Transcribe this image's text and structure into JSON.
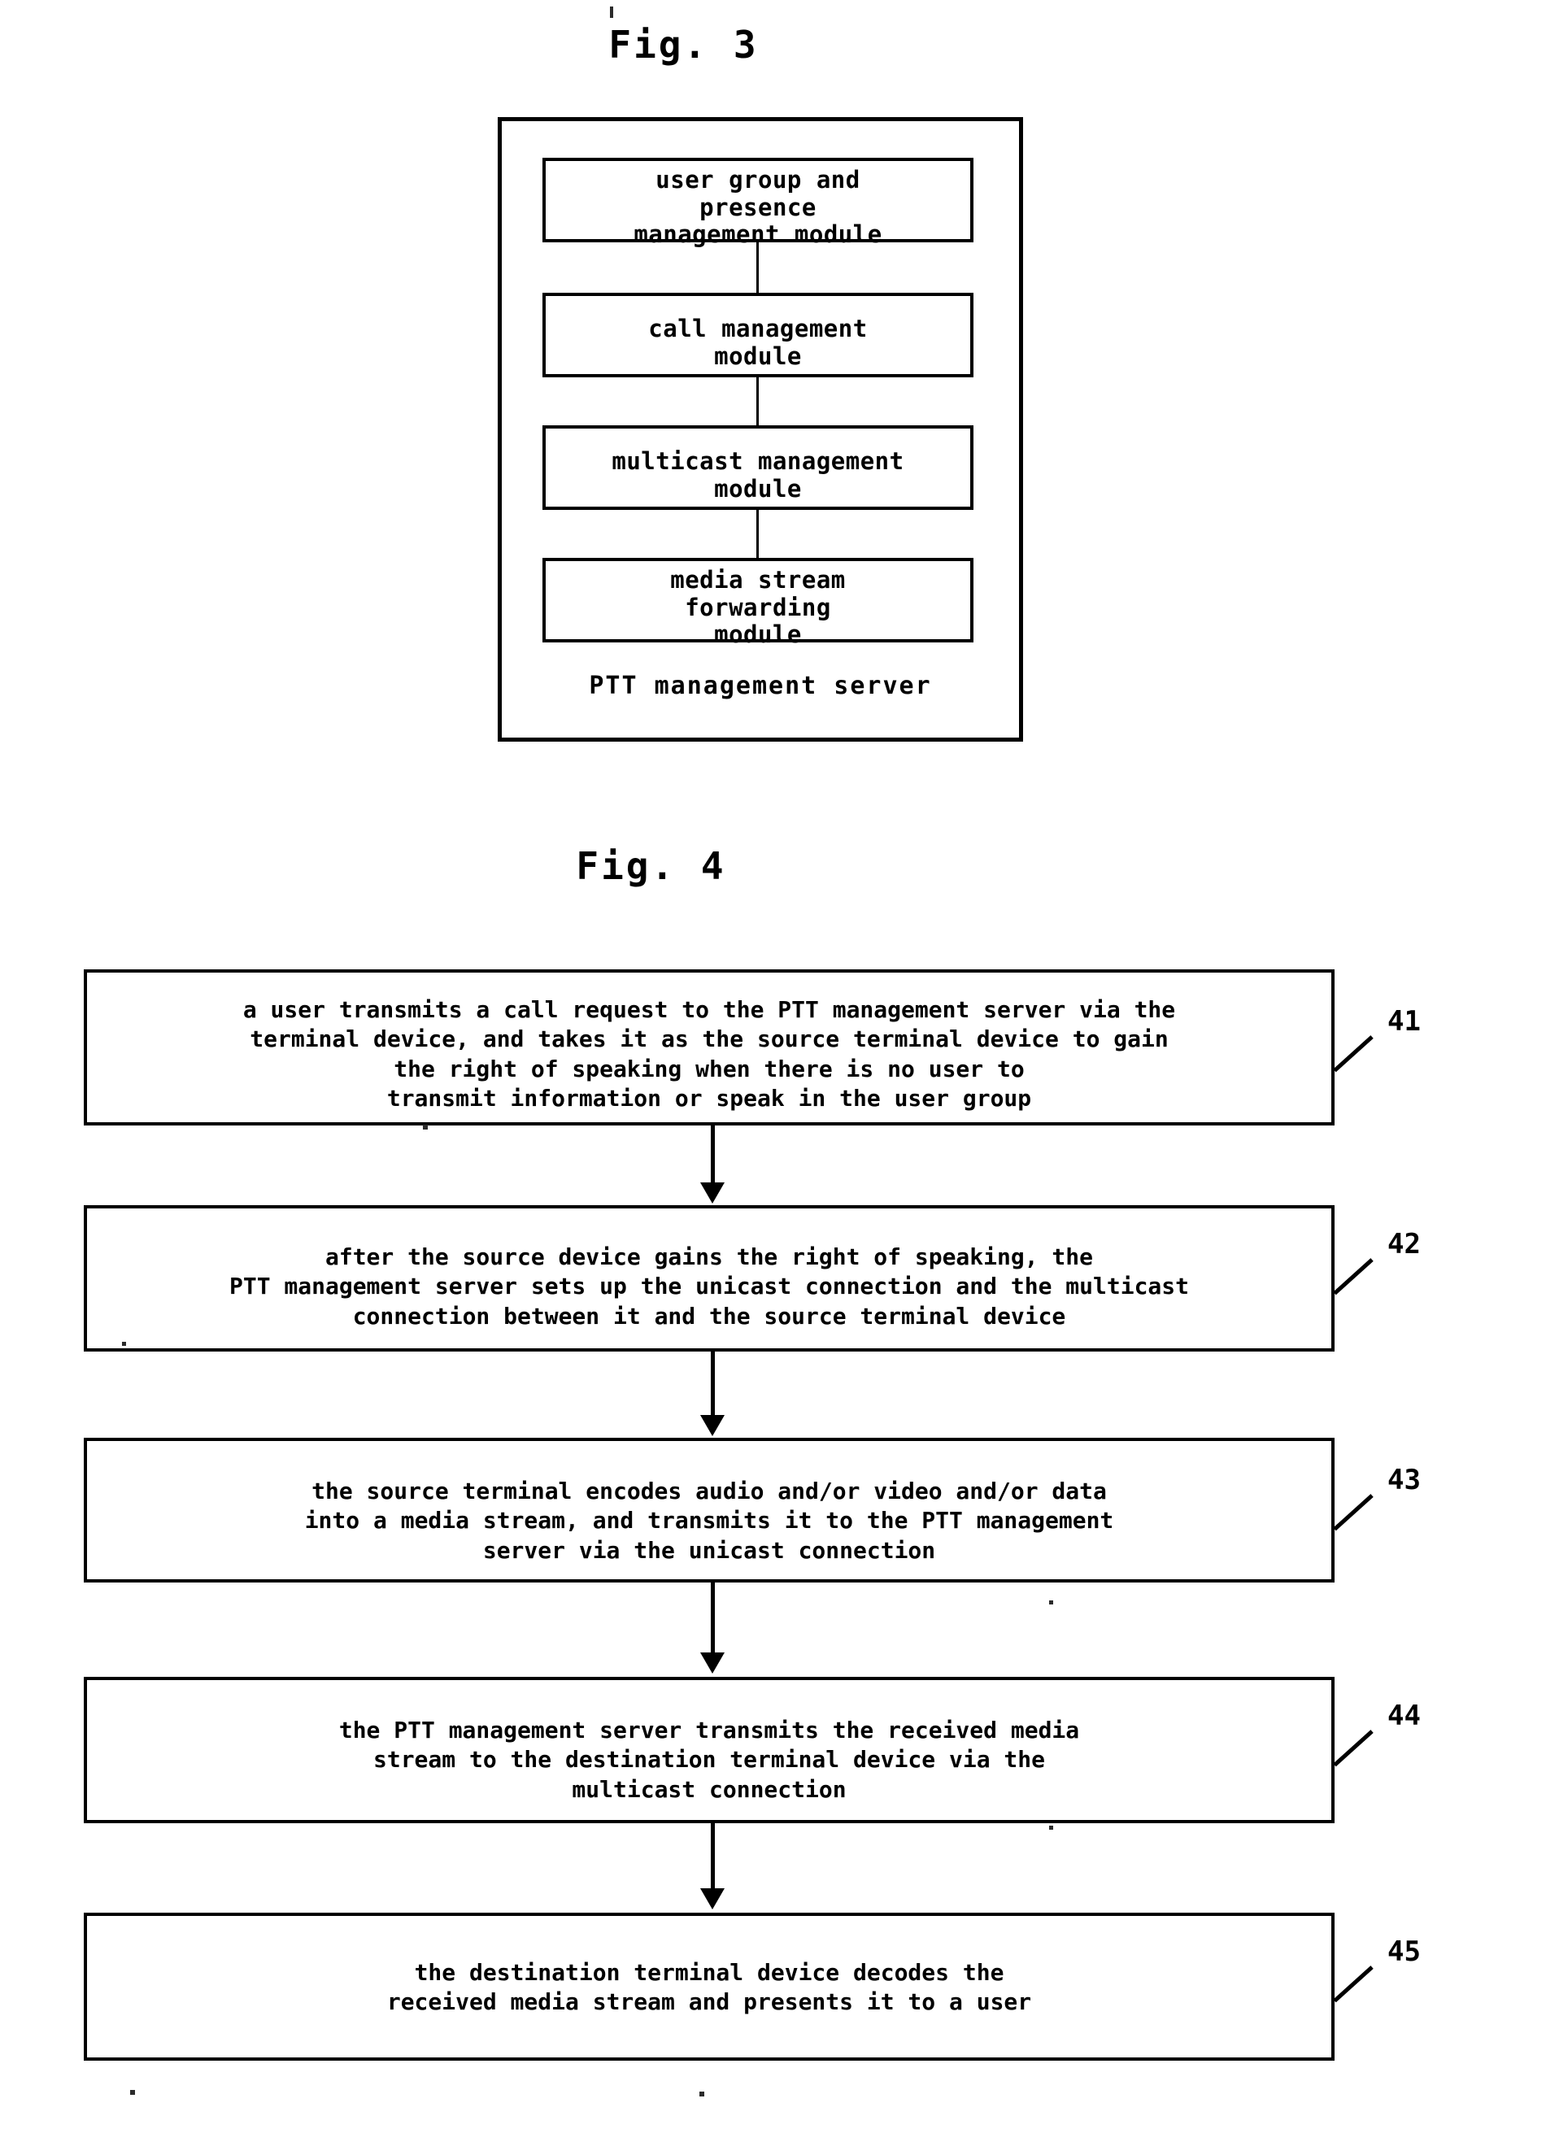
{
  "figures": [
    {
      "title": "Fig. 3",
      "type": "block-diagram",
      "container_label": "PTT management server",
      "modules": [
        {
          "id": "mod1",
          "label": "user group and\npresence\nmanagement module"
        },
        {
          "id": "mod2",
          "label": "call management\nmodule"
        },
        {
          "id": "mod3",
          "label": "multicast management\nmodule"
        },
        {
          "id": "mod4",
          "label": "media stream\nforwarding\nmodule"
        }
      ],
      "connectors": [
        {
          "from": "mod1",
          "to": "mod2",
          "style": "line"
        },
        {
          "from": "mod2",
          "to": "mod3",
          "style": "line"
        },
        {
          "from": "mod3",
          "to": "mod4",
          "style": "line"
        }
      ]
    },
    {
      "title": "Fig. 4",
      "type": "flowchart",
      "steps": [
        {
          "ref": "41",
          "text": "a user transmits a call request to the PTT management server via the\nterminal device, and takes it as the source terminal device to gain\nthe right of speaking when there is no user to\ntransmit information or speak in the user group"
        },
        {
          "ref": "42",
          "text": "after the source device gains the right of speaking, the\nPTT management server sets up the unicast connection and the multicast\nconnection between it and the source terminal device"
        },
        {
          "ref": "43",
          "text": "the source terminal encodes audio and/or video and/or data\ninto a media stream, and transmits it to the PTT management\nserver via the unicast connection"
        },
        {
          "ref": "44",
          "text": "the PTT management server transmits the received media\nstream to the destination terminal device via the\nmulticast connection"
        },
        {
          "ref": "45",
          "text": "the destination terminal device decodes the\nreceived media stream and presents it to a user"
        }
      ],
      "connectors": [
        {
          "from": "41",
          "to": "42",
          "style": "arrow-down"
        },
        {
          "from": "42",
          "to": "43",
          "style": "arrow-down"
        },
        {
          "from": "43",
          "to": "44",
          "style": "arrow-down"
        },
        {
          "from": "44",
          "to": "45",
          "style": "arrow-down"
        }
      ]
    }
  ],
  "colors": {
    "ink": "#000000",
    "paper": "#ffffff"
  }
}
